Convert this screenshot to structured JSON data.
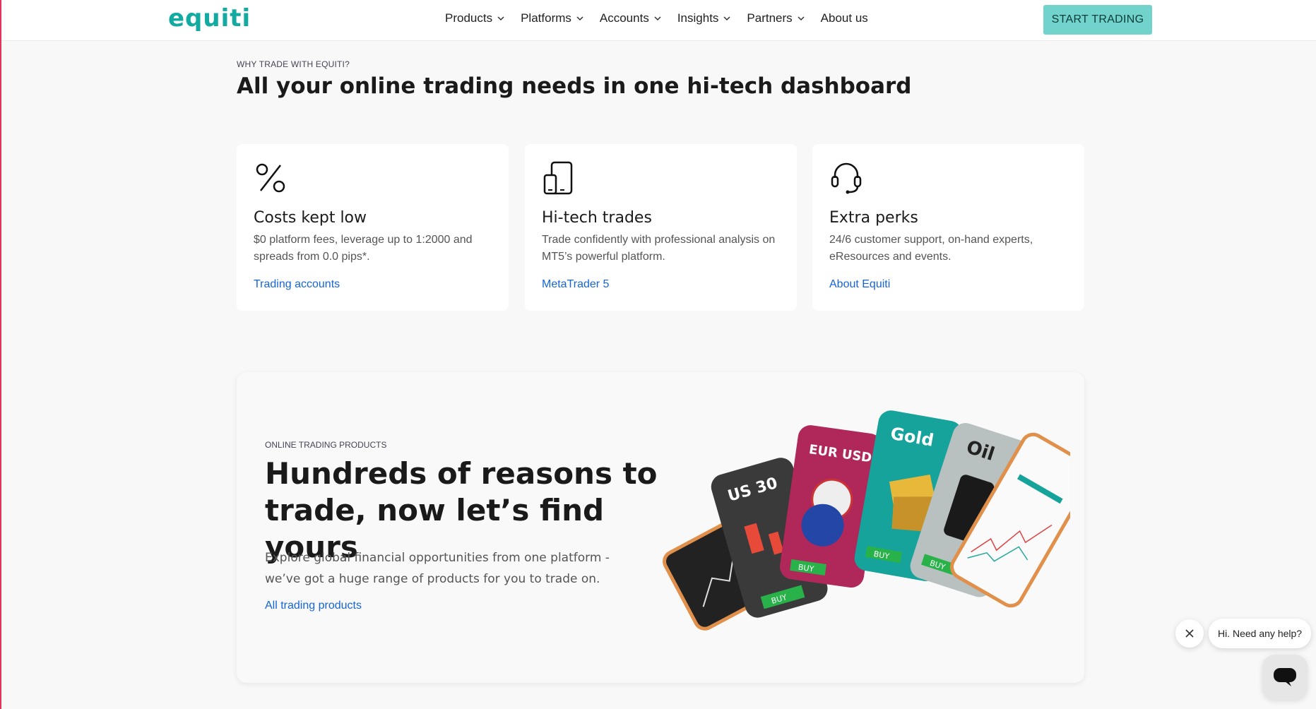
{
  "header": {
    "logo": "equiti",
    "nav": [
      {
        "label": "Products",
        "has_dropdown": true
      },
      {
        "label": "Platforms",
        "has_dropdown": true
      },
      {
        "label": "Accounts",
        "has_dropdown": true
      },
      {
        "label": "Insights",
        "has_dropdown": true
      },
      {
        "label": "Partners",
        "has_dropdown": true
      },
      {
        "label": "About us",
        "has_dropdown": false
      }
    ],
    "cta_label": "START TRADING"
  },
  "why": {
    "eyebrow": "WHY TRADE WITH EQUITI?",
    "title": "All your online trading needs in one hi-tech dashboard",
    "cards": [
      {
        "icon": "percent-icon",
        "title": "Costs kept low",
        "desc": "$0 platform fees, leverage up to 1:2000 and spreads from 0.0 pips*.",
        "link": "Trading accounts"
      },
      {
        "icon": "tablet-icon",
        "title": "Hi-tech trades",
        "desc": "Trade confidently with professional analysis on MT5’s powerful platform.",
        "link": "MetaTrader 5"
      },
      {
        "icon": "headset-icon",
        "title": "Extra perks",
        "desc": "24/6 customer support, on-hand experts, eResources and events.",
        "link": "About Equiti"
      }
    ]
  },
  "products": {
    "eyebrow": "ONLINE TRADING PRODUCTS",
    "title": "Hundreds of reasons to trade, now let’s find yours",
    "desc": "Explore global financial opportunities from one platform - we’ve got a huge range of products for you to trade on.",
    "link": "All trading products",
    "art_cards": [
      {
        "label": "US 30",
        "color": "#3a3a3a",
        "button": "BUY"
      },
      {
        "label": "EUR USD",
        "color": "#b0285a",
        "button": "BUY"
      },
      {
        "label": "Gold",
        "color": "#16a39c",
        "button": "BUY"
      },
      {
        "label": "Oil",
        "color": "#b8c0c0",
        "button": "BUY"
      }
    ]
  },
  "chat": {
    "bubble": "Hi. Need any help?"
  },
  "colors": {
    "brand": "#13aaa2",
    "cta": "#71d3cb",
    "link": "#1565d8"
  }
}
